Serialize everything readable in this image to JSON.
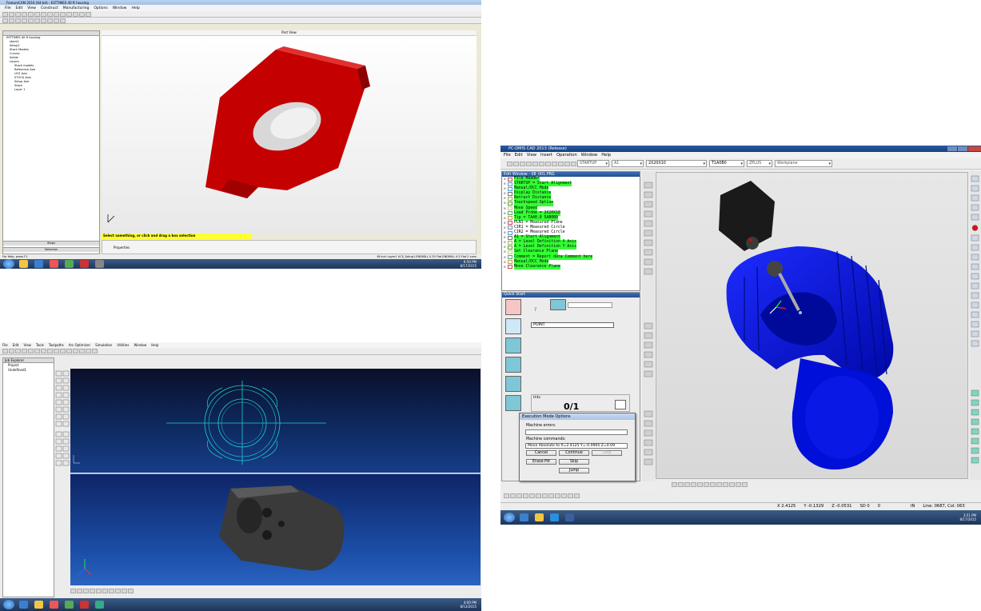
{
  "shot1": {
    "title": "FeatureCAM 2016 (64-bit) - ESTTIMES 40 ft housing",
    "menu": [
      "File",
      "Edit",
      "View",
      "Construct",
      "Manufacturing",
      "Options",
      "Window",
      "Help"
    ],
    "part_view_label": "Part View",
    "tree": [
      "ESTTIMES 40 ft housing",
      "stock1",
      "Setup1",
      "Stock Models",
      "Curves",
      "Solids",
      "Layers",
      "Stock models",
      "Reference Axe",
      "UCS Axis",
      "STOCK Axis",
      "Setup Axe",
      "Stock",
      "Layer 1"
    ],
    "stack_labels": [
      "Steps",
      "Selection"
    ],
    "status_message": "Select something, or click and drag a box selection",
    "properties_label": "Properties",
    "bottom_left": "For Help, press F1",
    "bottom_right": "IN  Inch  Layer1  UCS_Setup1  ENDMILL 0.25 Flat  ENDMILL 0.5 Flat  2 conv",
    "clock_time": "6:50 PM",
    "clock_date": "8/17/2015",
    "colors": {
      "part": "#c40000",
      "viewport": "#ffffff"
    }
  },
  "shot2": {
    "menu": [
      "File",
      "Edit",
      "View",
      "Tools",
      "Toolpaths",
      "Arc Optimizer",
      "Simulation",
      "Utilities",
      "Window",
      "Help"
    ],
    "explorer_title": "Job Explorer",
    "explorer_items": [
      "Project",
      "Undefined1"
    ],
    "clock_time": "4:00 PM",
    "clock_date": "8/13/2015",
    "colors": {
      "top_view": "#0e2b63",
      "bottom_view": "#1b4ea8",
      "sketch": "#1fd0d0",
      "part": "#3a3a3a"
    }
  },
  "shot3": {
    "title": "PC-DMIS CAD 2013 (Release)",
    "menu": [
      "File",
      "Edit",
      "View",
      "Insert",
      "Operation",
      "Window",
      "Help"
    ],
    "combos": [
      "STARTUP",
      "A1",
      "2X20X10",
      "T1A0B0",
      "ZPLUS",
      "Workplane"
    ],
    "edit_window_title": "Edit Window - 08_001.PRG",
    "commands": [
      {
        "text": "File Header",
        "hl": true
      },
      {
        "text": "STARTUP = Start Alignment",
        "hl": true
      },
      {
        "text": "Manual/DCC Mode",
        "hl": true
      },
      {
        "text": "Display Distance",
        "hl": true
      },
      {
        "text": "Retract Distance",
        "hl": true
      },
      {
        "text": "Touchspeed Option",
        "hl": true
      },
      {
        "text": "Move Speed",
        "hl": true
      },
      {
        "text": "Load Probe = 2X20X10",
        "hl": true
      },
      {
        "text": "Tip = TA40.0 5AB0B0",
        "hl": true
      },
      {
        "text": "PLN1 = Measured Plane",
        "hl": false
      },
      {
        "text": "CIR1 = Measured Circle",
        "hl": false
      },
      {
        "text": "CIR2 = Measured Circle",
        "hl": false
      },
      {
        "text": "A1 = Start Alignment",
        "hl": true
      },
      {
        "text": "A = Level Definition X Axis",
        "hl": true
      },
      {
        "text": "A = Level Definition Y Axis",
        "hl": true
      },
      {
        "text": "Set Clearance Plane",
        "hl": true
      },
      {
        "text": "Comment = Report data Comment here",
        "hl": true
      },
      {
        "text": "Manual/DCC Mode",
        "hl": true
      },
      {
        "text": "Move Clearance Plane",
        "hl": true
      }
    ],
    "quick_start_title": "Quick Start",
    "feature_select": "POINT",
    "hits_label": "Hits",
    "hits_value": "0/1",
    "dialog": {
      "title": "Execution Mode Options",
      "machine_errors_label": "Machine errors:",
      "machine_commands_label": "Machine commands:",
      "command_value": "Move Absolute to X=2.4125 Y=-0.0965 Z=0.09",
      "buttons": [
        "Cancel",
        "Continue",
        "Stop",
        "Erase-Hit",
        "Skip",
        "Jump"
      ]
    },
    "status": {
      "x": "X  2.4125",
      "y": "Y  -0.1329",
      "z": "Z  -0.0531",
      "sd": "SD  0",
      "zero": "0",
      "units": "IN",
      "line": "Line: 0687, Col: 063"
    },
    "clock_time": "3:51 PM",
    "clock_date": "8/17/2015",
    "colors": {
      "part": "#0a14d8",
      "probe_body": "#1a1a1a",
      "edit_highlight": "#33ff33"
    }
  }
}
